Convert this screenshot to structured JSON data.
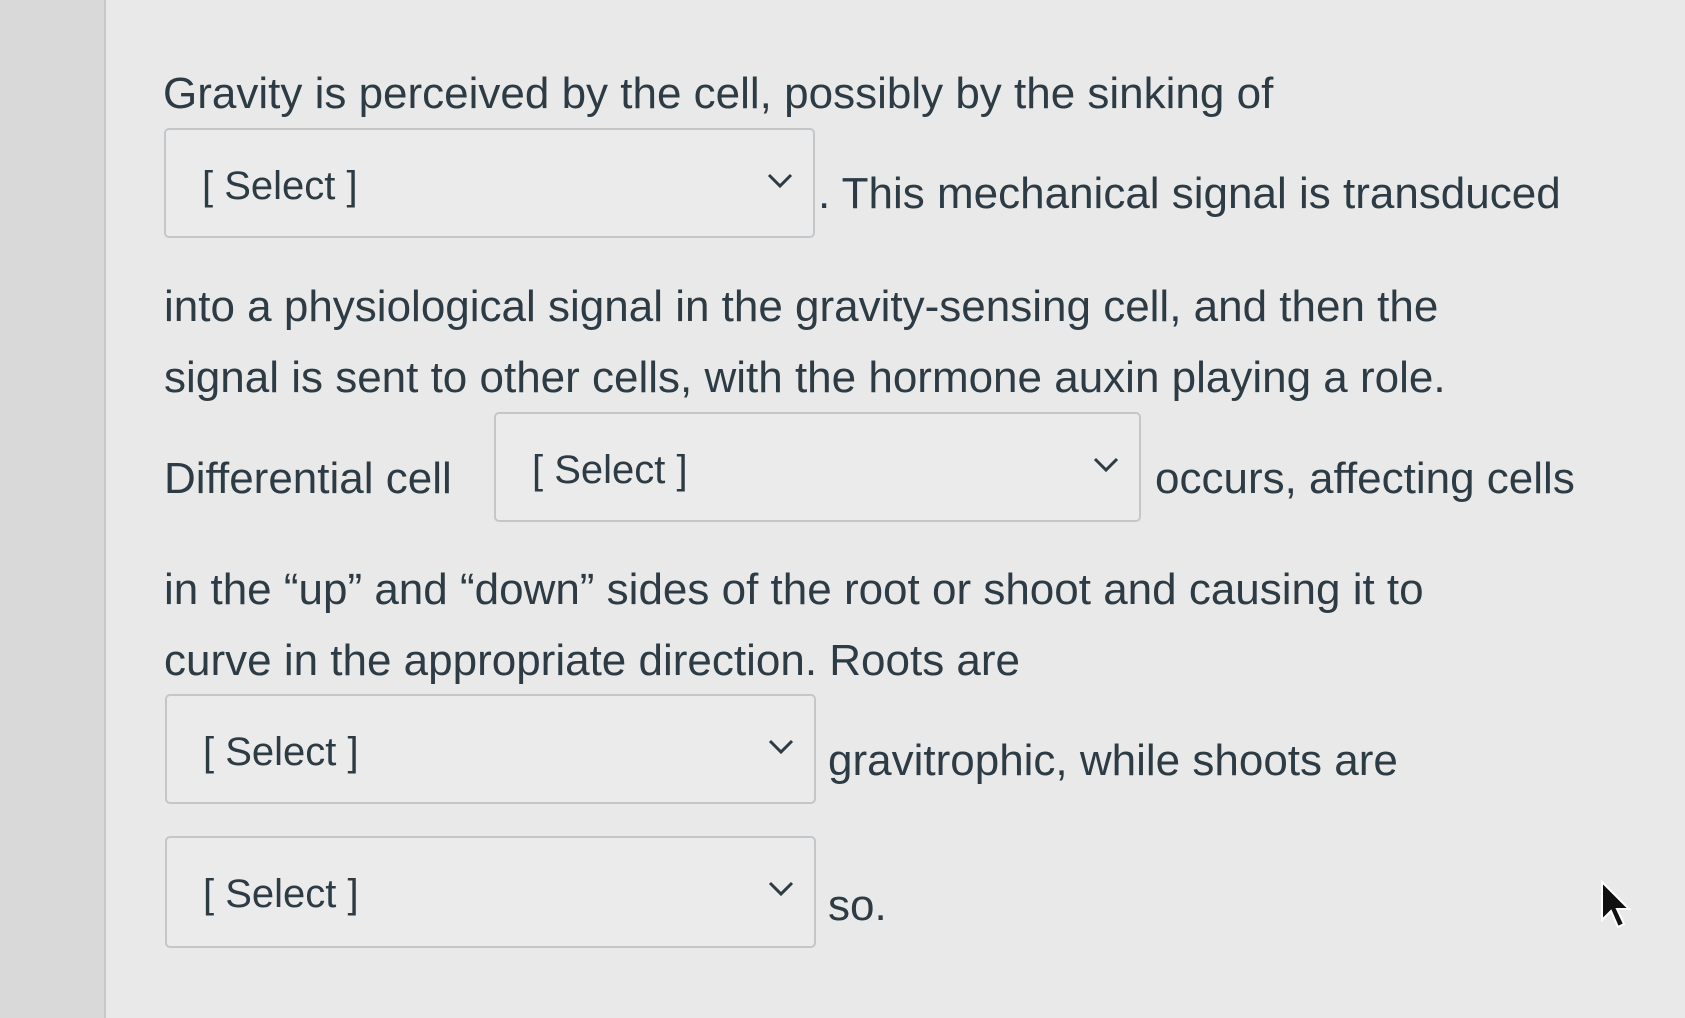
{
  "question": {
    "line1": "Gravity is perceived by the cell, possibly by the sinking of",
    "line2_after": ". This mechanical signal is transduced",
    "line3": "into a physiological signal in the gravity-sensing cell, and then the",
    "line4": "signal is sent to other cells, with the hormone auxin playing a role.",
    "line5_before": "Differential cell",
    "line5_after": "occurs, affecting cells",
    "line6": "in the “up” and “down” sides of the root or shoot and causing it to",
    "line7": "curve in the appropriate direction. Roots are",
    "line8_after": "gravitrophic, while shoots are",
    "line9_after": "so."
  },
  "dropdowns": [
    {
      "selected": "[ Select ]"
    },
    {
      "selected": "[ Select ]"
    },
    {
      "selected": "[ Select ]"
    },
    {
      "selected": "[ Select ]"
    }
  ],
  "icons": {
    "dropdown_arrow": "chevron-down-icon",
    "pointer": "mouse-cursor-icon"
  }
}
